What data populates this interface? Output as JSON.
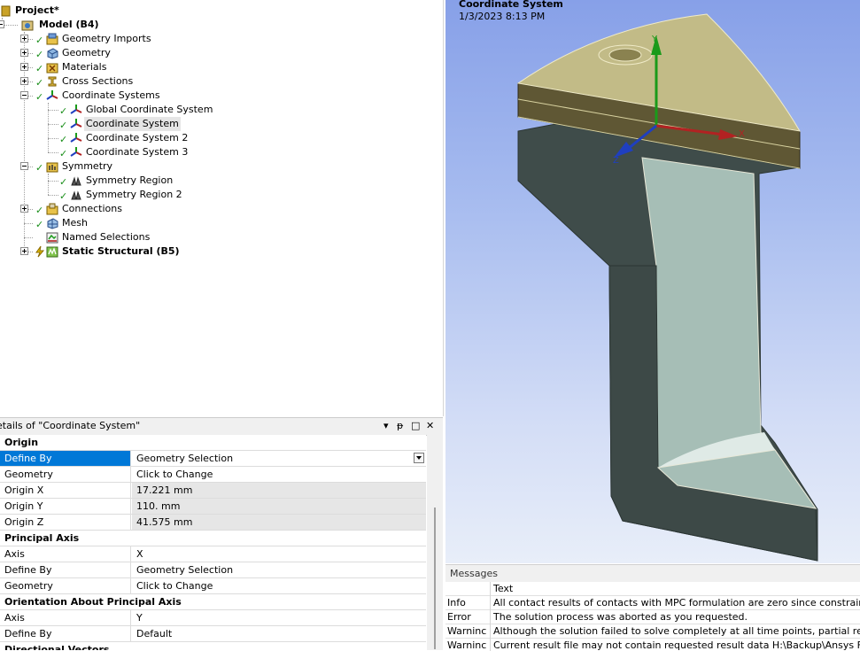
{
  "tree": {
    "project_label": "Project*",
    "model_label": "Model (B4)",
    "items": [
      {
        "label": "Geometry Imports",
        "icon": "geometry-imports-icon"
      },
      {
        "label": "Geometry",
        "icon": "geometry-icon"
      },
      {
        "label": "Materials",
        "icon": "materials-icon"
      },
      {
        "label": "Cross Sections",
        "icon": "cross-sections-icon"
      },
      {
        "label": "Coordinate Systems",
        "icon": "coordinate-systems-icon"
      },
      {
        "label": "Global Coordinate System",
        "icon": "coordinate-system-icon"
      },
      {
        "label": "Coordinate System",
        "icon": "coordinate-system-icon"
      },
      {
        "label": "Coordinate System 2",
        "icon": "coordinate-system-icon"
      },
      {
        "label": "Coordinate System 3",
        "icon": "coordinate-system-icon"
      },
      {
        "label": "Symmetry",
        "icon": "symmetry-icon"
      },
      {
        "label": "Symmetry Region",
        "icon": "symmetry-region-icon"
      },
      {
        "label": "Symmetry Region 2",
        "icon": "symmetry-region-icon"
      },
      {
        "label": "Connections",
        "icon": "connections-icon"
      },
      {
        "label": "Mesh",
        "icon": "mesh-icon"
      },
      {
        "label": "Named Selections",
        "icon": "named-selections-icon"
      },
      {
        "label": "Static Structural (B5)",
        "icon": "static-structural-icon"
      }
    ]
  },
  "details": {
    "title": "etails of \"Coordinate System\"",
    "header_buttons": [
      "▾",
      "ᵽ",
      "□",
      "✕"
    ],
    "rows": [
      {
        "type": "section",
        "label": "Origin"
      },
      {
        "label": "Define By",
        "value": "Geometry Selection"
      },
      {
        "label": "Geometry",
        "value": "Click to Change"
      },
      {
        "label": "Origin X",
        "value": "17.221 mm"
      },
      {
        "label": "Origin Y",
        "value": "110. mm"
      },
      {
        "label": "Origin Z",
        "value": "41.575 mm"
      },
      {
        "type": "section",
        "label": "Principal Axis"
      },
      {
        "label": "Axis",
        "value": "X"
      },
      {
        "label": "Define By",
        "value": "Geometry Selection"
      },
      {
        "label": "Geometry",
        "value": "Click to Change"
      },
      {
        "type": "section",
        "label": "Orientation About Principal Axis"
      },
      {
        "label": "Axis",
        "value": "Y"
      },
      {
        "label": "Define By",
        "value": "Default"
      },
      {
        "type": "section",
        "label": "Directional Vectors"
      }
    ]
  },
  "viewport": {
    "title": "Coordinate System",
    "date": "1/3/2023 8:13 PM",
    "axis_labels": {
      "x": "X",
      "y": "Y",
      "z": "Z"
    },
    "colors": {
      "model_top": "#c2bb87",
      "model_side": "#3f4c4a",
      "model_face": "#a6beb6",
      "x_axis": "#b22222",
      "y_axis": "#1a9a1a",
      "z_axis": "#1f3fc0"
    }
  },
  "messages": {
    "title": "Messages",
    "column_header": "Text",
    "rows": [
      {
        "type": "Info",
        "text": "All contact results of contacts with MPC formulation are zero since constraint equ"
      },
      {
        "type": "Error",
        "text": "The solution process was aborted as you requested."
      },
      {
        "type": "Warninc",
        "text": "Although the solution failed to solve completely at all time points, partial results"
      },
      {
        "type": "Warninc",
        "text": "Current result file may not contain requested result data H:\\Backup\\Ansys FEA\\Ar"
      }
    ]
  }
}
